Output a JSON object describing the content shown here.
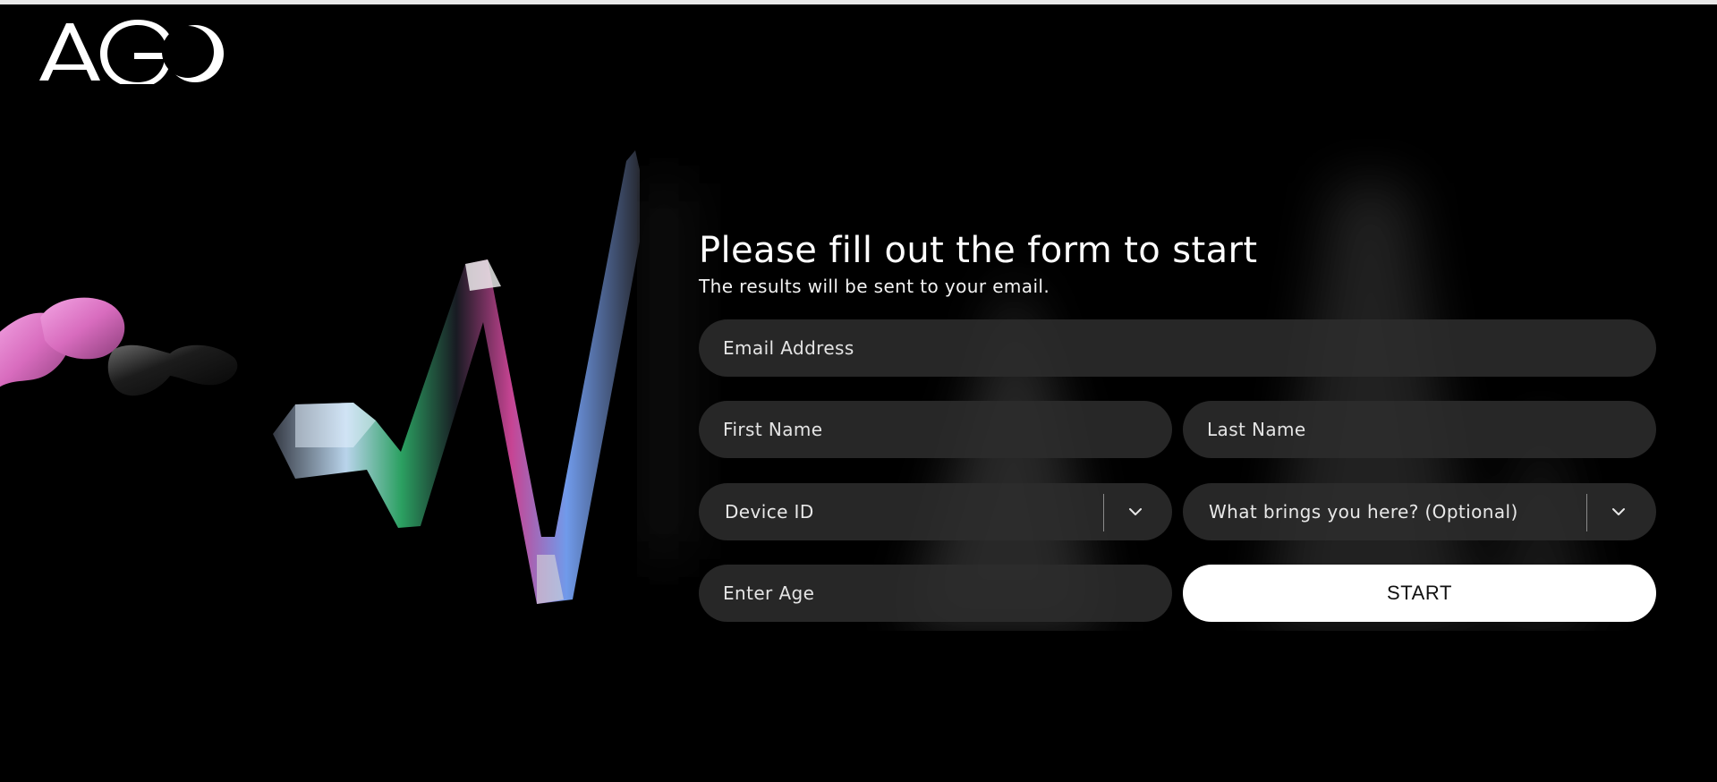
{
  "brand": {
    "logo_text": "AGO"
  },
  "form": {
    "title": "Please fill out the form to start",
    "subtitle": "The results will be sent to your email.",
    "email_placeholder": "Email Address",
    "first_name_placeholder": "First Name",
    "last_name_placeholder": "Last Name",
    "device_select_label": "Device ID",
    "reason_select_label": "What brings you here? (Optional)",
    "age_placeholder": "Enter Age",
    "start_label": "START"
  },
  "icons": {
    "select_chevron": "chevron-down-icon"
  },
  "colors": {
    "background": "#000000",
    "field_fill": "#2c2c2c",
    "button_fill": "#ffffff",
    "button_text": "#111111",
    "accent_pink": "#e07bc8"
  }
}
